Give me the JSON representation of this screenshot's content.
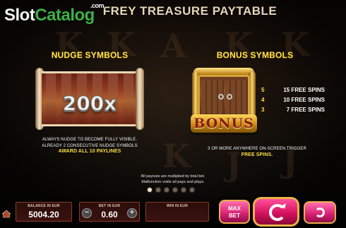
{
  "header": {
    "title": "FREY TREASURE   PAYTABLE",
    "watermark_prefix": "Slot",
    "watermark_accent": "Catalog",
    "watermark_suffix": ".com"
  },
  "nudge": {
    "title": "NUDGE SYMBOLS",
    "multiplier": "200x",
    "line1": "ALWAYS NUDGE TO BECOME FULLY VISIBLE.",
    "line2": "ALREADY 2 CONSECUTIVE NUDGE SYMBOLS",
    "highlight": "AWARD ALL 10 PAYLINES"
  },
  "bonus": {
    "title": "BONUS SYMBOLS",
    "plate_text": "BONUS",
    "paytable": [
      {
        "count": "5",
        "reward": "15 FREE SPINS"
      },
      {
        "count": "4",
        "reward": "10 FREE SPINS"
      },
      {
        "count": "3",
        "reward": "7 FREE SPINS"
      }
    ],
    "line1": "3 OR MORE ANYWHERE ON-SCREEN TRIGGER",
    "highlight": "FREE SPINS."
  },
  "footnote": {
    "line1": "All payouts are multiplied by total bet.",
    "line2": "Malfunction voids all pays and plays."
  },
  "pager": {
    "count": 6,
    "active_index": 0
  },
  "bottom_bar": {
    "balance": {
      "label": "BALANCE IN EUR",
      "value": "5004.20"
    },
    "bet": {
      "label": "BET IN EUR",
      "value": "0.60",
      "minus": "−",
      "plus": "+"
    },
    "win": {
      "label": "WIN IN EUR",
      "value": ""
    },
    "maxbet": {
      "line1": "MAX",
      "line2": "BET"
    }
  },
  "colors": {
    "accent_gold": "#ffe14a",
    "button_pink": "#d61f72",
    "field_border": "#8a3b2a"
  },
  "icons": {
    "home": "home-icon",
    "spin": "spin-arrow-icon",
    "autoplay": "autoplay-icon"
  }
}
